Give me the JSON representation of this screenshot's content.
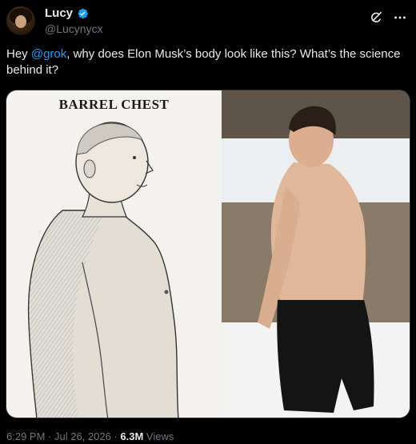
{
  "author": {
    "display_name": "Lucy",
    "handle": "@Lucynycx",
    "verified": true
  },
  "tweet": {
    "text_before": "Hey ",
    "mention": "@grok",
    "text_after": ", why does Elon Musk’s body look like this?  What’s the science behind it?"
  },
  "media": {
    "left_label": "BARREL CHEST"
  },
  "footer": {
    "time": "6:29 PM",
    "separator": " · ",
    "date": "Jul 26, 2026",
    "views_count": "6.3M",
    "views_label": " Views"
  },
  "icons": {
    "verified": "verified-badge-icon",
    "grok": "grok-icon",
    "more": "more-options-icon"
  },
  "colors": {
    "background": "#000000",
    "text": "#e7e9ea",
    "muted": "#71767b",
    "accent": "#1d9bf0"
  }
}
